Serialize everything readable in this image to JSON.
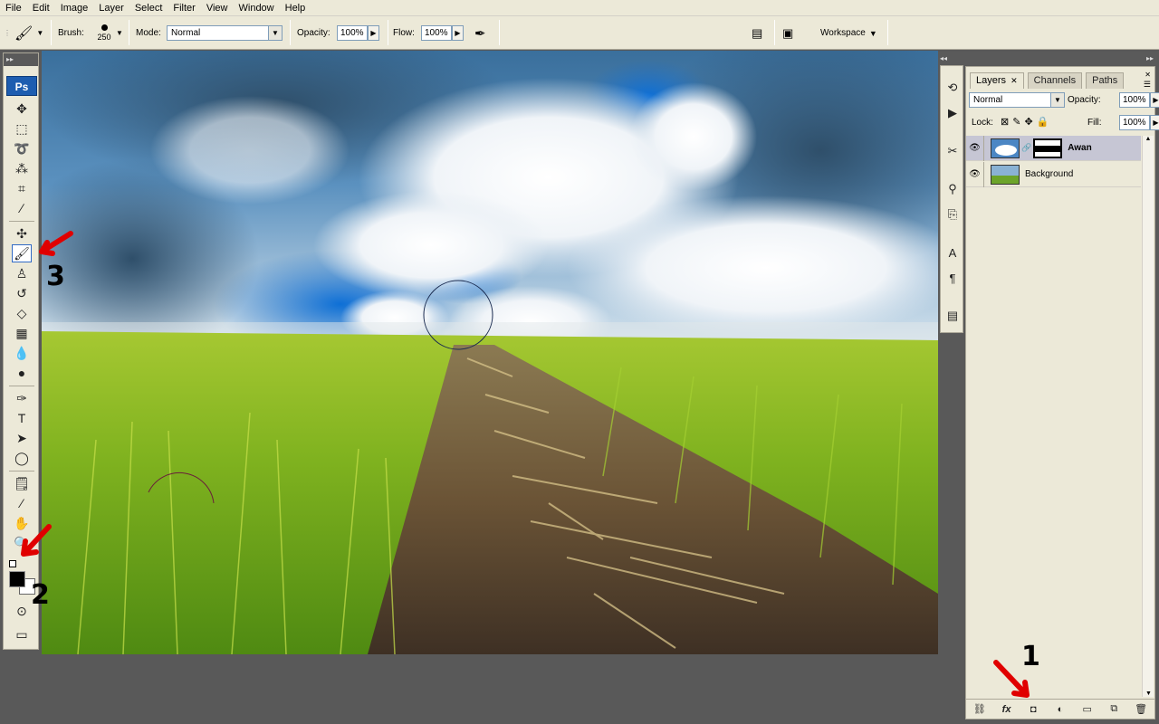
{
  "menu": [
    "File",
    "Edit",
    "Image",
    "Layer",
    "Select",
    "Filter",
    "View",
    "Window",
    "Help"
  ],
  "options": {
    "brush_label": "Brush:",
    "brush_size": "250",
    "mode_label": "Mode:",
    "mode_value": "Normal",
    "opacity_label": "Opacity:",
    "opacity_value": "100%",
    "flow_label": "Flow:",
    "flow_value": "100%",
    "workspace_label": "Workspace"
  },
  "tools": {
    "logo": "Ps"
  },
  "layers_panel": {
    "tabs": [
      "Layers",
      "Channels",
      "Paths"
    ],
    "blend_mode": "Normal",
    "opacity_label": "Opacity:",
    "opacity_value": "100%",
    "lock_label": "Lock:",
    "fill_label": "Fill:",
    "fill_value": "100%",
    "layers": [
      {
        "name": "Awan",
        "selected": true
      },
      {
        "name": "Background",
        "selected": false
      }
    ]
  },
  "annotations": {
    "step1": "1",
    "step2": "2",
    "step3": "3"
  },
  "colors": {
    "accent": "#1d5db0",
    "annotation_arrow": "#e00000"
  }
}
